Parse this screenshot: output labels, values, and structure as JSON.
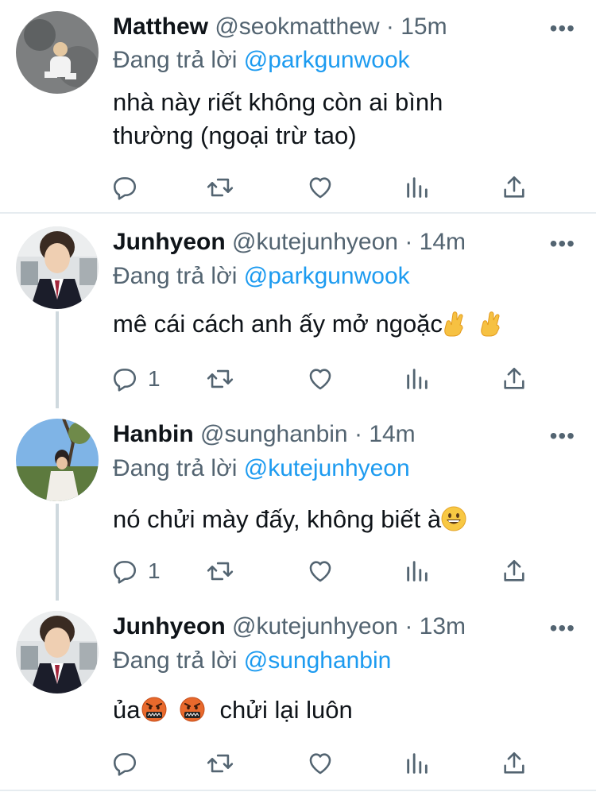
{
  "reply_prefix": "Đang trả lời",
  "tweets": [
    {
      "name": "Matthew",
      "handle": "@seokmatthew",
      "separator": "·",
      "time": "15m",
      "reply_to": "@parkgunwook",
      "text": "nhà này riết không còn ai bình thường (ngoại trừ tao)",
      "reply_count": ""
    },
    {
      "name": "Junhyeon",
      "handle": "@kutejunhyeon",
      "separator": "·",
      "time": "14m",
      "reply_to": "@parkgunwook",
      "text": "mê cái cách anh ấy mở ngoặc",
      "reply_count": "1"
    },
    {
      "name": "Hanbin",
      "handle": "@sunghanbin",
      "separator": "·",
      "time": "14m",
      "reply_to": "@kutejunhyeon",
      "text": "nó chửi mày đấy, không biết à",
      "reply_count": "1"
    },
    {
      "name": "Junhyeon",
      "handle": "@kutejunhyeon",
      "separator": "·",
      "time": "13m",
      "reply_to": "@sunghanbin",
      "text_a": "ủa",
      "text_b": "chửi lại luôn",
      "reply_count": ""
    }
  ],
  "icons": {
    "reply": "reply-icon",
    "retweet": "retweet-icon",
    "like": "heart-icon",
    "views": "analytics-icon",
    "share": "share-icon",
    "more": "more-icon"
  },
  "colors": {
    "mention": "#1d9bf0",
    "secondary_text": "#536471",
    "thread_line": "#cfd9de"
  }
}
